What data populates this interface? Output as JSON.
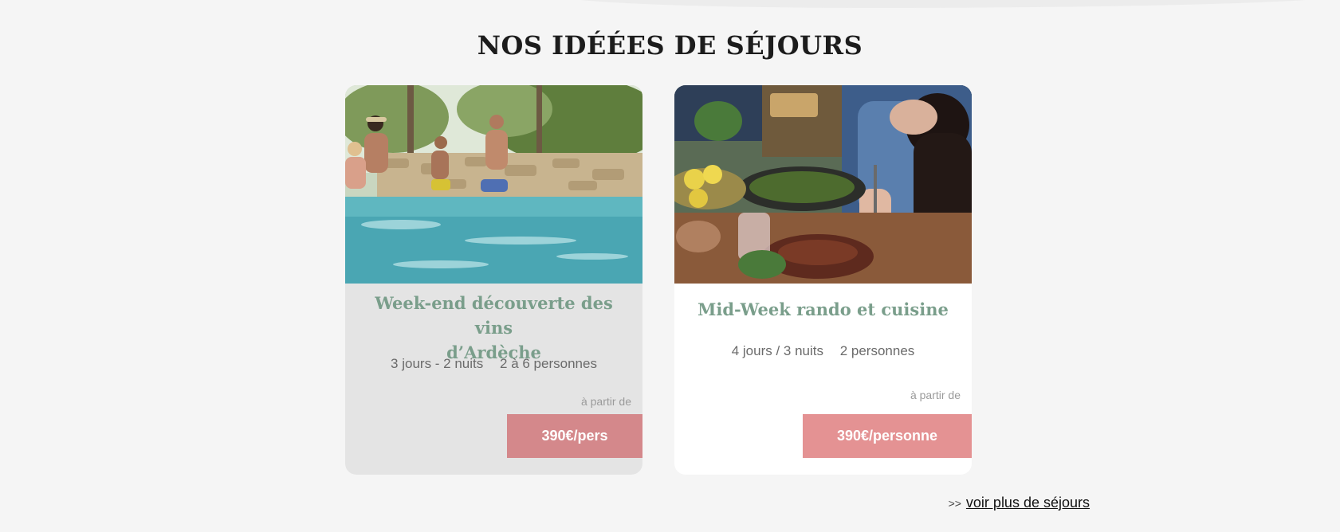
{
  "section": {
    "title": "NOS IDÉÉES DE SÉJOURS"
  },
  "cards": [
    {
      "title_line1": "Week-end découverte des vins",
      "title_line2": "d’Ardèche",
      "duration": "3 jours - 2 nuits",
      "people": "2 à 6 personnes",
      "from_label": "à partir de",
      "price": "390€/pers",
      "price_color": "#d4888b",
      "image": "pool-family-photo"
    },
    {
      "title": "Mid-Week rando et cuisine",
      "duration": "4 jours / 3 nuits",
      "people": "2 personnes",
      "from_label": "à partir de",
      "price": "390€/personne",
      "price_color": "#e49293",
      "image": "dinner-table-photo"
    }
  ],
  "more_link": {
    "arrows": ">>",
    "label": "voir plus de séjours"
  },
  "colors": {
    "title_green": "#7a9e8b",
    "background": "#f5f5f5"
  }
}
